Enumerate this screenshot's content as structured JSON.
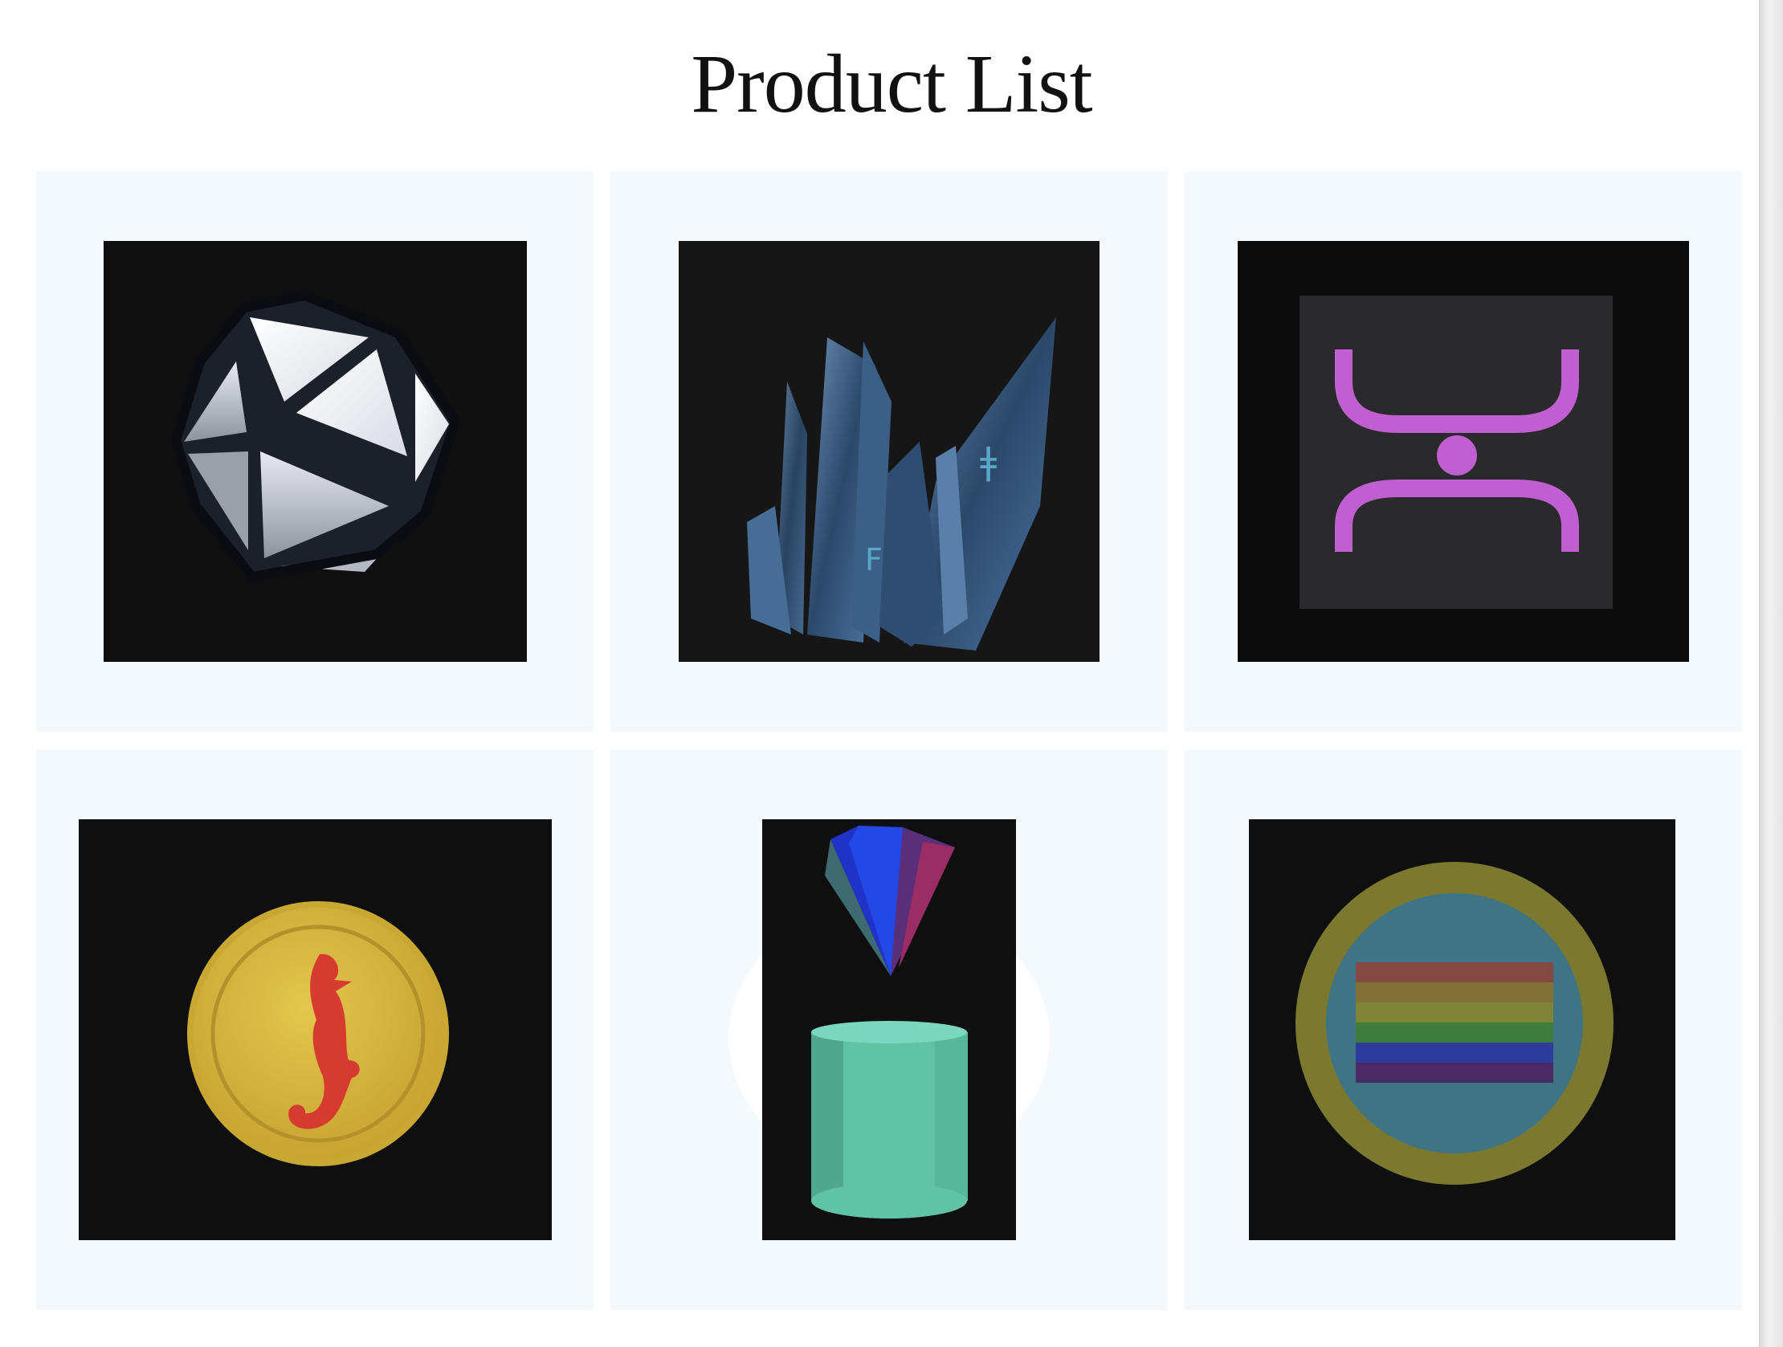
{
  "page": {
    "title": "Product List"
  },
  "products": [
    {
      "icon": "icosahedron-icon"
    },
    {
      "icon": "crystal-cluster-icon"
    },
    {
      "icon": "purple-logo-icon"
    },
    {
      "icon": "seahorse-coin-icon"
    },
    {
      "icon": "gem-and-cylinder-icon"
    },
    {
      "icon": "rainbow-flag-coin-icon"
    }
  ],
  "colors": {
    "card_background": "#f3f9fd",
    "thumbnail_background": "#0f0f10",
    "logo_accent": "#c05fcf",
    "coin_gold": "#d9bf45",
    "seahorse_red": "#d63b2f",
    "cylinder_green": "#63c4a5"
  }
}
